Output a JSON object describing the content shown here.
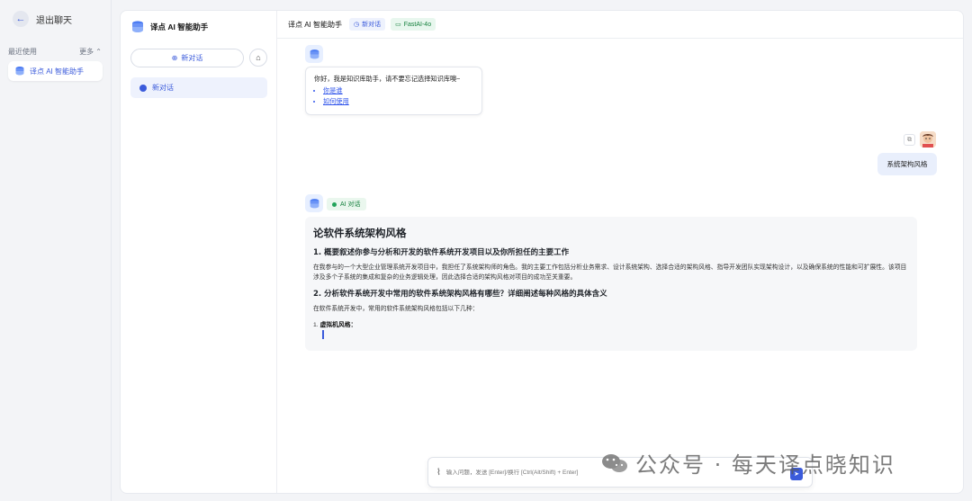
{
  "rail": {
    "back_label": "退出聊天",
    "recent_label": "最近使用",
    "more_label": "更多 ⌃",
    "app_name": "译点 AI 智能助手"
  },
  "sidebar": {
    "brand": "译点 AI 智能助手",
    "new_chat_label": "新对话",
    "history": [
      {
        "label": "新对话"
      }
    ]
  },
  "topbar": {
    "title": "译点 AI 智能助手",
    "tag_new": "新对话",
    "tag_model": "FastAI-4o"
  },
  "welcome": {
    "greeting": "你好，我是知识库助手，请不要忘记选择知识库噢~",
    "links": [
      "你是谁",
      "如何使用"
    ]
  },
  "user_message": "系统架构风格",
  "ai_tag": "AI 对话",
  "answer": {
    "title": "论软件系统架构风格",
    "h1": "1. 概要叙述你参与分析和开发的软件系统开发项目以及你所担任的主要工作",
    "p1": "在我参与的一个大型企业管理系统开发项目中，我担任了系统架构师的角色。我的主要工作包括分析业务需求、设计系统架构、选择合适的架构风格、指导开发团队实现架构设计，以及确保系统的性能和可扩展性。该项目涉及多个子系统的集成和复杂的业务逻辑处理，因此选择合适的架构风格对项目的成功至关重要。",
    "h2": "2. 分析软件系统开发中常用的软件系统架构风格有哪些？详细阐述每种风格的具体含义",
    "p2": "在软件系统开发中，常用的软件系统架构风格包括以下几种：",
    "item1_num": "1.",
    "item1": "虚拟机风格："
  },
  "input": {
    "placeholder": "输入问题，发送 [Enter]/换行 [Ctrl(Alt/Shift) + Enter]"
  },
  "watermark": "公众号 · 每天译点晓知识",
  "colors": {
    "accent": "#3b5bdb",
    "success": "#15803d"
  }
}
